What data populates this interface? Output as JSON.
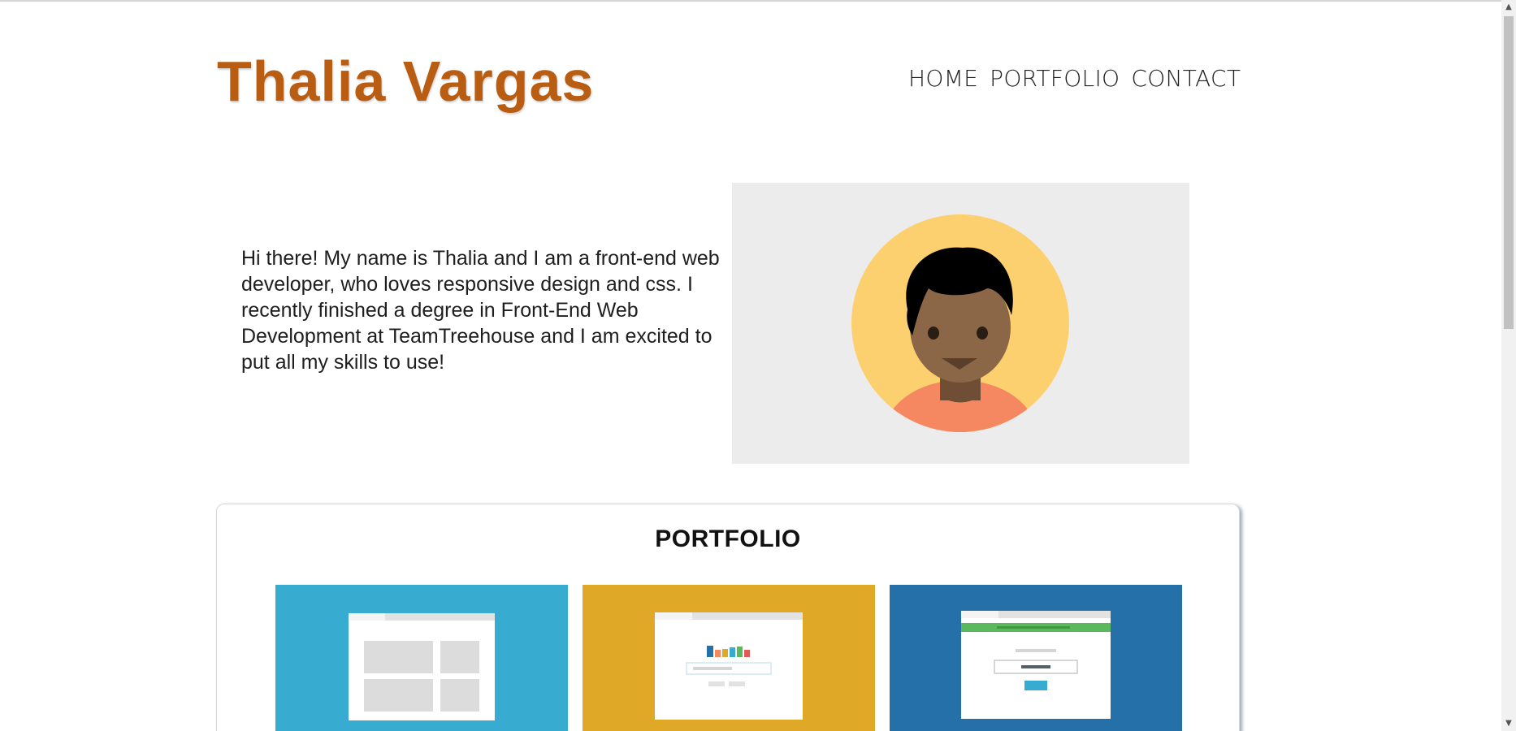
{
  "header": {
    "title": "Thalia Vargas",
    "nav": [
      "HOME",
      "PORTFOLIO",
      "CONTACT"
    ]
  },
  "intro": {
    "text": "Hi there! My name is Thalia and I am a front-end web developer, who loves responsive design and css. I recently finished a degree in Front-End Web Development at TeamTreehouse and I am excited to put all my skills to use!"
  },
  "portfolio": {
    "heading": "PORTFOLIO",
    "tiles": [
      {
        "icon": "layout-mockup-icon",
        "color": "#38abd1"
      },
      {
        "icon": "chart-form-mockup-icon",
        "color": "#dfa927"
      },
      {
        "icon": "login-form-mockup-icon",
        "color": "#2670a9"
      }
    ]
  },
  "colors": {
    "title": "#b95d12",
    "avatar_bg": "#ececec",
    "avatar_circle": "#fdd06f",
    "skin": "#8b6647",
    "shirt": "#f58761"
  },
  "scrollbar": {
    "up_icon": "chevron-up-icon",
    "down_icon": "chevron-down-icon"
  }
}
